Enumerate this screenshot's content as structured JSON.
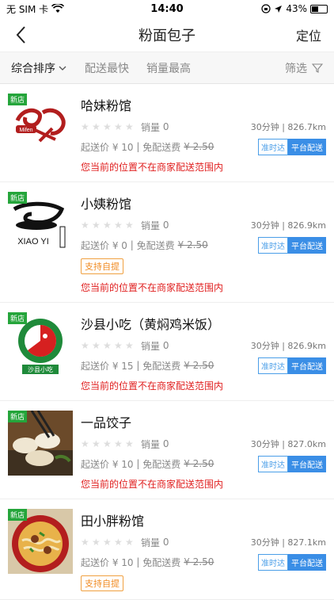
{
  "status": {
    "carrier": "无 SIM 卡",
    "time": "14:40",
    "battery": "43%"
  },
  "nav": {
    "title": "粉面包子",
    "locate_label": "定位"
  },
  "sort": {
    "items": [
      {
        "label": "综合排序"
      },
      {
        "label": "配送最快"
      },
      {
        "label": "销量最高"
      }
    ],
    "filter_label": "筛选"
  },
  "common": {
    "new_tag": "新店",
    "sales_label": "销量",
    "ontime_badge": "准时达",
    "platform_badge": "平台配送",
    "warning": "您当前的位置不在商家配送范围内",
    "pickup_label": "支持自提"
  },
  "stores": [
    {
      "name": "哈妹粉馆",
      "logo_text": "Mifen",
      "sales": "0",
      "time": "30分钟",
      "distance": "826.7km",
      "min_order": "起送价 ¥ 10",
      "free_delivery": "免配送费",
      "old_fee": "¥ 2.50",
      "pickup": false
    },
    {
      "name": "小姨粉馆",
      "logo_text": "XIAO YI",
      "sales": "0",
      "time": "30分钟",
      "distance": "826.9km",
      "min_order": "起送价 ¥ 0",
      "free_delivery": "免配送费",
      "old_fee": "¥ 2.50",
      "pickup": true
    },
    {
      "name": "沙县小吃（黄焖鸡米饭）",
      "logo_text": "沙县小吃",
      "sales": "0",
      "time": "30分钟",
      "distance": "826.9km",
      "min_order": "起送价 ¥ 15",
      "free_delivery": "免配送费",
      "old_fee": "¥ 2.50",
      "pickup": false
    },
    {
      "name": "一品饺子",
      "logo_text": "",
      "sales": "0",
      "time": "30分钟",
      "distance": "827.0km",
      "min_order": "起送价 ¥ 10",
      "free_delivery": "免配送费",
      "old_fee": "¥ 2.50",
      "pickup": false
    },
    {
      "name": "田小胖粉馆",
      "logo_text": "",
      "sales": "0",
      "time": "30分钟",
      "distance": "827.1km",
      "min_order": "起送价 ¥ 10",
      "free_delivery": "免配送费",
      "old_fee": "¥ 2.50",
      "pickup": true
    }
  ]
}
